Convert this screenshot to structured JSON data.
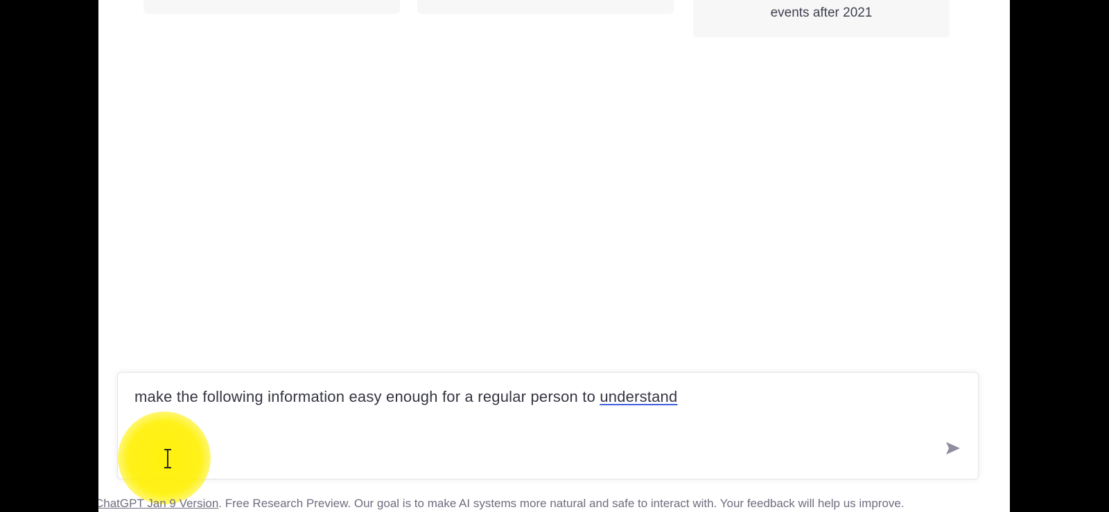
{
  "examples": {
    "card3_text": "events after 2021"
  },
  "prompt": {
    "value_main": "make the following information easy enough for a regular person to ",
    "value_flagged_word": "understand",
    "send_icon": "send-icon"
  },
  "footer": {
    "version_link": "ChatGPT Jan 9 Version",
    "text": ". Free Research Preview. Our goal is to make AI systems more natural and safe to interact with. Your feedback will help us improve."
  },
  "colors": {
    "highlight": "#fff000",
    "text": "#343541",
    "footer": "#6e6e80"
  }
}
